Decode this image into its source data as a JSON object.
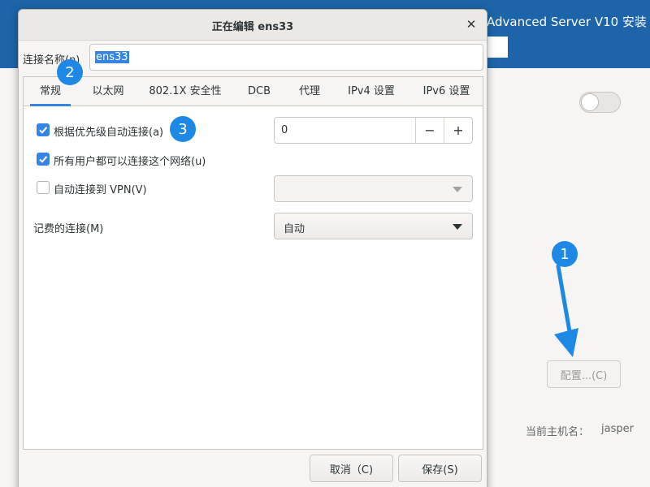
{
  "background": {
    "window_title": "Advanced Server V10 安装",
    "configure_button": "配置...(C)",
    "hostname_label": "当前主机名：",
    "hostname_value": "jasper"
  },
  "dialog": {
    "title": "正在编辑 ens33",
    "close_icon": "close-icon",
    "connection_name_label": "连接名称(n)",
    "connection_name_value": "ens33",
    "tabs": [
      {
        "label": "常规",
        "active": true
      },
      {
        "label": "以太网",
        "active": false
      },
      {
        "label": "802.1X 安全性",
        "active": false
      },
      {
        "label": "DCB",
        "active": false
      },
      {
        "label": "代理",
        "active": false
      },
      {
        "label": "IPv4 设置",
        "active": false
      },
      {
        "label": "IPv6 设置",
        "active": false
      }
    ],
    "general": {
      "auto_connect_priority_label": "根据优先级自动连接(a)",
      "auto_connect_priority_checked": true,
      "priority_value": "0",
      "all_users_label": "所有用户都可以连接这个网络(u)",
      "all_users_checked": true,
      "auto_vpn_label": "自动连接到 VPN(V)",
      "auto_vpn_checked": false,
      "metered_label": "记费的连接(M)",
      "metered_value": "自动"
    },
    "cancel_button": "取消（C)",
    "save_button": "保存(S)"
  },
  "annotations": {
    "marker_1": "1",
    "marker_2": "2",
    "marker_3": "3",
    "accent_color": "#1e88e5"
  }
}
